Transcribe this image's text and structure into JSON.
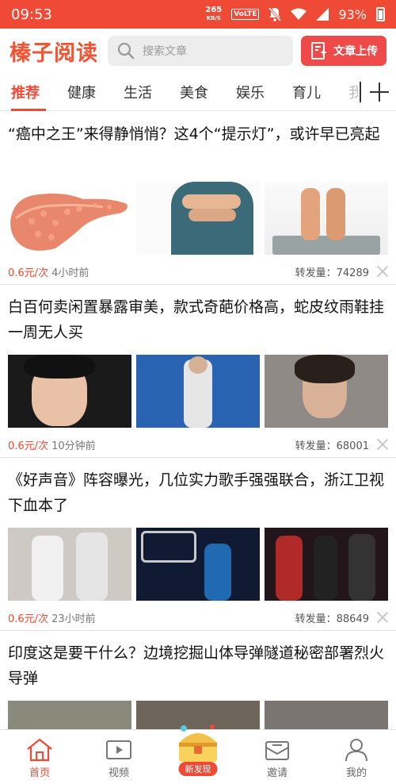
{
  "status": {
    "time": "09:53",
    "net_speed_top": "265",
    "net_speed_bottom": "KB/S",
    "volte": "VoLTE",
    "battery": "93%"
  },
  "header": {
    "logo": "榛子阅读",
    "search_placeholder": "搜索文章",
    "upload_label": "文章上传",
    "accent": "#ef4a36"
  },
  "tabs": [
    {
      "label": "推荐",
      "active": true
    },
    {
      "label": "健康"
    },
    {
      "label": "生活"
    },
    {
      "label": "美食"
    },
    {
      "label": "娱乐"
    },
    {
      "label": "育儿"
    },
    {
      "label": "我"
    }
  ],
  "articles": [
    {
      "title": "“癌中之王”来得静悄悄？这4个“提示灯”，或许早已亮起",
      "price": "0.6元/次",
      "time": "4小时前",
      "shares_label": "转发量：",
      "shares": "74289"
    },
    {
      "title": "白百何卖闲置暴露审美，款式奇葩价格高，蛇皮纹雨鞋挂一周无人买",
      "price": "0.6元/次",
      "time": "10分钟前",
      "shares_label": "转发量：",
      "shares": "68001"
    },
    {
      "title": "《好声音》阵容曝光，几位实力歌手强强联合，浙江卫视下血本了",
      "price": "0.6元/次",
      "time": "23小时前",
      "shares_label": "转发量：",
      "shares": "88649"
    },
    {
      "title": "印度这是要干什么？边境挖掘山体导弹隧道秘密部署烈火导弹",
      "price": "",
      "time": "",
      "shares_label": "",
      "shares": ""
    }
  ],
  "bottom_nav": [
    {
      "label": "首页",
      "icon": "home-icon",
      "active": true
    },
    {
      "label": "视频",
      "icon": "video-icon"
    },
    {
      "label": "新发现",
      "icon": "treasure-chest-icon"
    },
    {
      "label": "邀请",
      "icon": "envelope-icon"
    },
    {
      "label": "我的",
      "icon": "person-icon"
    }
  ]
}
